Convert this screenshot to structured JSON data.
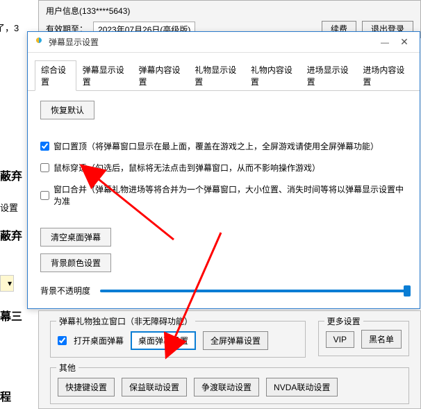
{
  "bgLeft": {
    "t1": "蔽弃",
    "t2": "设置",
    "t3": "蔽弃",
    "t4": "幕三",
    "t5": "程",
    "topInline": "了，3"
  },
  "parent": {
    "userInfo": "用户信息(133****5643)",
    "dateLabel": "有效期至：",
    "dateValue": "2023年07月26日(高级版)",
    "btn1": "续费",
    "btn2": "退出登录"
  },
  "dialog": {
    "title": "弹幕显示设置",
    "tabs": [
      "综合设置",
      "弹幕显示设置",
      "弹幕内容设置",
      "礼物显示设置",
      "礼物内容设置",
      "进场显示设置",
      "进场内容设置"
    ],
    "restoreDefault": "恢复默认",
    "chk1": "窗口置顶（将弹幕窗口显示在最上面，覆盖在游戏之上，全屏游戏请使用全屏弹幕功能）",
    "chk2": "鼠标穿透（勾选后，鼠标将无法点击到弹幕窗口，从而不影响操作游戏）",
    "chk3": "窗口合并（弹幕礼物进场等将合并为一个弹幕窗口，大小位置、消失时间等将以弹幕显示设置中为准",
    "clearDesktop": "清空桌面弹幕",
    "bgColorSetting": "背景颜色设置",
    "opacityLabel": "背景不透明度"
  },
  "lower": {
    "group1Legend": "弹幕礼物独立窗口（非无障碍功能）",
    "chkOpen": "打开桌面弹幕",
    "btnDesktop": "桌面弹幕设置",
    "btnFullscreen": "全屏弹幕设置",
    "group2Legend": "更多设置",
    "btnVip": "VIP",
    "btnBlack": "黑名单",
    "group3Legend": "其他",
    "btnHotkey": "快捷键设置",
    "btnBaoyi": "保益联动设置",
    "btnZhengdu": "争渡联动设置",
    "btnNvda": "NVDA联动设置"
  }
}
